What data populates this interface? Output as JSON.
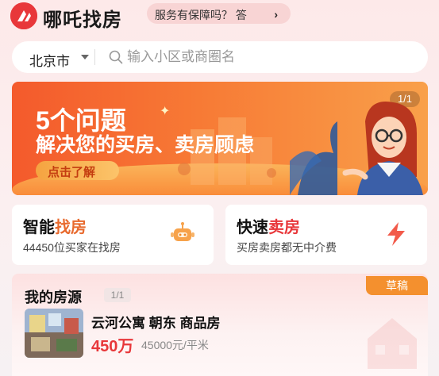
{
  "header": {
    "app_name": "哪吒找房",
    "guarantee_text": "服务有保障吗？ 答",
    "guarantee_chevron": "›"
  },
  "search": {
    "city": "北京市",
    "placeholder": "输入小区或商圈名"
  },
  "banner": {
    "title_line1": "5个问题",
    "title_line2": "解决您的买房、卖房顾虑",
    "cta": "点击了解",
    "counter": "1/1"
  },
  "features": [
    {
      "title_prefix": "智能",
      "title_highlight": "找房",
      "subtitle": "44450位买家在找房",
      "icon": "robot-icon"
    },
    {
      "title_prefix": "快速",
      "title_highlight": "卖房",
      "subtitle": "买房卖房都无中介费",
      "icon": "lightning-icon"
    }
  ],
  "my_listings": {
    "title": "我的房源",
    "count": "1/1",
    "status_tag": "草稿",
    "items": [
      {
        "name": "云河公寓 朝东 商品房",
        "price": "450万",
        "unit_price": "45000元/平米"
      }
    ]
  },
  "colors": {
    "brand_red": "#e8373a",
    "accent_orange": "#f4902e"
  }
}
